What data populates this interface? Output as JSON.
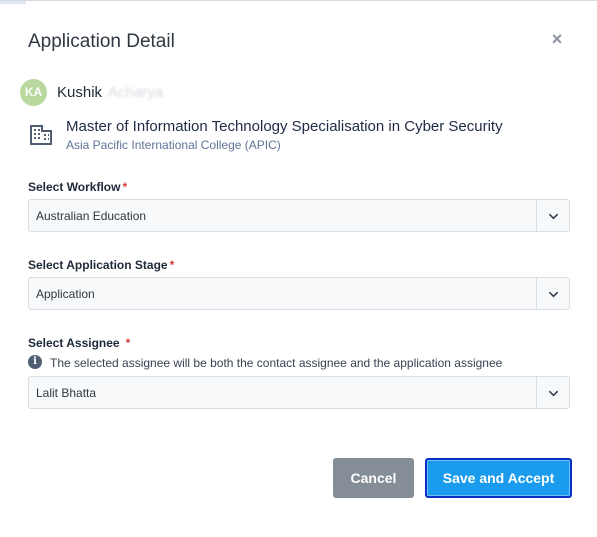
{
  "dialog": {
    "title": "Application Detail",
    "close_glyph": "×",
    "close_icon": "close-icon"
  },
  "contact": {
    "initials": "KA",
    "first_name": "Kushik",
    "surname_redacted": "Acharya"
  },
  "course": {
    "icon": "building-icon",
    "title": "Master of Information Technology Specialisation in Cyber Security",
    "college": "Asia Pacific International College (APIC)"
  },
  "fields": {
    "workflow": {
      "label": "Select Workflow",
      "required_mark": "*",
      "value": "Australian Education"
    },
    "stage": {
      "label": "Select Application Stage",
      "required_mark": "*",
      "value": "Application"
    },
    "assignee": {
      "label": "Select Assignee",
      "required_mark": "*",
      "info_glyph": "i",
      "info_text": "The selected assignee will be both the contact assignee and the application assignee",
      "value": "Lalit Bhatta"
    }
  },
  "actions": {
    "cancel_label": "Cancel",
    "save_label": "Save and Accept"
  },
  "colors": {
    "avatar": "#b8d89d",
    "primary": "#1a9bee",
    "primary_focus": "#0a2fc6",
    "secondary": "#858d97",
    "required": "#d63d3d",
    "link_text": "#5f7396"
  }
}
